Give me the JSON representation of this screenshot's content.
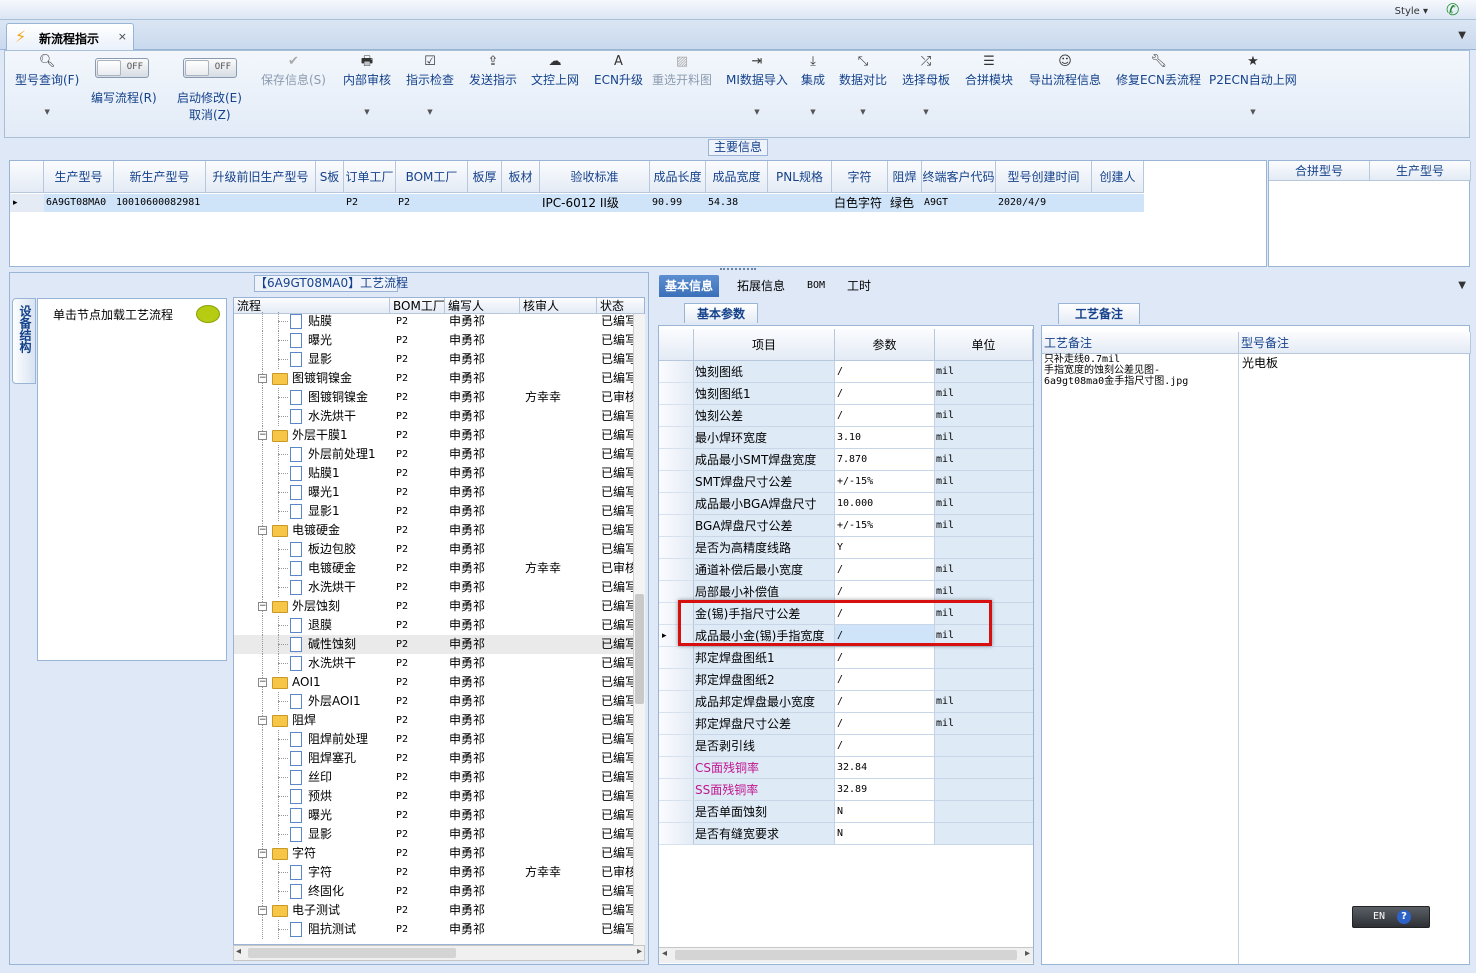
{
  "titlebar": {
    "style_label": "Style"
  },
  "doc_tab": {
    "title": "新流程指示",
    "close": "×"
  },
  "ribbon": {
    "query": "型号查询(F)",
    "edit_flow": "编写流程(R)",
    "edit_toggle": "OFF",
    "auto_edit": "启动修改(E)",
    "auto_toggle": "OFF",
    "cancel": "取消(Z)",
    "save": "保存信息(S)",
    "internal_review": "内部审核",
    "guide_check": "指示检查",
    "send": "发送指示",
    "upload": "文控上网",
    "ecn_upgrade": "ECN升级",
    "reselect": "重选开料图",
    "mi_import": "MI数据导入",
    "integrate": "集成",
    "compare": "数据对比",
    "select_board": "选择母板",
    "merge": "合拼模块",
    "export": "导出流程信息",
    "fix_ecn": "修复ECN丢流程",
    "p2ecn": "P2ECN自动上网"
  },
  "main_info": {
    "title": "主要信息",
    "columns": [
      "生产型号",
      "新生产型号",
      "升级前旧生产型号",
      "S板",
      "订单工厂",
      "BOM工厂",
      "板厚",
      "板材",
      "验收标准",
      "成品长度",
      "成品宽度",
      "PNL规格",
      "字符",
      "阻焊",
      "终端客户代码",
      "型号创建时间",
      "创建人"
    ],
    "row": [
      "6A9GT08MA0",
      "10010600082981",
      "",
      "",
      "P2",
      "P2",
      "",
      "",
      "IPC-6012 II级",
      "90.99",
      "54.38",
      "",
      "白色字符",
      "绿色",
      "A9GT",
      "2020/4/9",
      ""
    ],
    "side_columns": [
      "合拼型号",
      "生产型号"
    ]
  },
  "flow": {
    "title": "【6A9GT08MA0】工艺流程",
    "vertical_tab": "设备结构",
    "node_hint": "单击节点加载工艺流程",
    "columns": [
      "流程",
      "BOM工厂",
      "编写人",
      "核审人",
      "状态"
    ],
    "rows": [
      {
        "name": "贴膜",
        "level": 2,
        "type": "doc",
        "bom": "P2",
        "writer": "申勇祁",
        "reviewer": "",
        "status": "已编写"
      },
      {
        "name": "曝光",
        "level": 2,
        "type": "doc",
        "bom": "P2",
        "writer": "申勇祁",
        "reviewer": "",
        "status": "已编写"
      },
      {
        "name": "显影",
        "level": 2,
        "type": "doc",
        "bom": "P2",
        "writer": "申勇祁",
        "reviewer": "",
        "status": "已编写"
      },
      {
        "name": "图镀铜镍金",
        "level": 1,
        "type": "folder",
        "bom": "P2",
        "writer": "申勇祁",
        "reviewer": "",
        "status": "已编写"
      },
      {
        "name": "图镀铜镍金",
        "level": 2,
        "type": "doc",
        "bom": "P2",
        "writer": "申勇祁",
        "reviewer": "方幸幸",
        "status": "已审核"
      },
      {
        "name": "水洗烘干",
        "level": 2,
        "type": "doc",
        "bom": "P2",
        "writer": "申勇祁",
        "reviewer": "",
        "status": "已编写"
      },
      {
        "name": "外层干膜1",
        "level": 1,
        "type": "folder",
        "bom": "P2",
        "writer": "申勇祁",
        "reviewer": "",
        "status": "已编写"
      },
      {
        "name": "外层前处理1",
        "level": 2,
        "type": "doc",
        "bom": "P2",
        "writer": "申勇祁",
        "reviewer": "",
        "status": "已编写"
      },
      {
        "name": "贴膜1",
        "level": 2,
        "type": "doc",
        "bom": "P2",
        "writer": "申勇祁",
        "reviewer": "",
        "status": "已编写"
      },
      {
        "name": "曝光1",
        "level": 2,
        "type": "doc",
        "bom": "P2",
        "writer": "申勇祁",
        "reviewer": "",
        "status": "已编写"
      },
      {
        "name": "显影1",
        "level": 2,
        "type": "doc",
        "bom": "P2",
        "writer": "申勇祁",
        "reviewer": "",
        "status": "已编写"
      },
      {
        "name": "电镀硬金",
        "level": 1,
        "type": "folder",
        "bom": "P2",
        "writer": "申勇祁",
        "reviewer": "",
        "status": "已编写"
      },
      {
        "name": "板边包胶",
        "level": 2,
        "type": "doc",
        "bom": "P2",
        "writer": "申勇祁",
        "reviewer": "",
        "status": "已编写"
      },
      {
        "name": "电镀硬金",
        "level": 2,
        "type": "doc",
        "bom": "P2",
        "writer": "申勇祁",
        "reviewer": "方幸幸",
        "status": "已审核"
      },
      {
        "name": "水洗烘干",
        "level": 2,
        "type": "doc",
        "bom": "P2",
        "writer": "申勇祁",
        "reviewer": "",
        "status": "已编写"
      },
      {
        "name": "外层蚀刻",
        "level": 1,
        "type": "folder",
        "bom": "P2",
        "writer": "申勇祁",
        "reviewer": "",
        "status": "已编写"
      },
      {
        "name": "退膜",
        "level": 2,
        "type": "doc",
        "bom": "P2",
        "writer": "申勇祁",
        "reviewer": "",
        "status": "已编写"
      },
      {
        "name": "碱性蚀刻",
        "level": 2,
        "type": "doc",
        "bom": "P2",
        "writer": "申勇祁",
        "reviewer": "",
        "status": "已编写",
        "selected": true
      },
      {
        "name": "水洗烘干",
        "level": 2,
        "type": "doc",
        "bom": "P2",
        "writer": "申勇祁",
        "reviewer": "",
        "status": "已编写"
      },
      {
        "name": "AOI1",
        "level": 1,
        "type": "folder",
        "bom": "P2",
        "writer": "申勇祁",
        "reviewer": "",
        "status": "已编写"
      },
      {
        "name": "外层AOI1",
        "level": 2,
        "type": "doc",
        "bom": "P2",
        "writer": "申勇祁",
        "reviewer": "",
        "status": "已编写"
      },
      {
        "name": "阻焊",
        "level": 1,
        "type": "folder",
        "bom": "P2",
        "writer": "申勇祁",
        "reviewer": "",
        "status": "已编写"
      },
      {
        "name": "阻焊前处理",
        "level": 2,
        "type": "doc",
        "bom": "P2",
        "writer": "申勇祁",
        "reviewer": "",
        "status": "已编写"
      },
      {
        "name": "阻焊塞孔",
        "level": 2,
        "type": "doc",
        "bom": "P2",
        "writer": "申勇祁",
        "reviewer": "",
        "status": "已编写"
      },
      {
        "name": "丝印",
        "level": 2,
        "type": "doc",
        "bom": "P2",
        "writer": "申勇祁",
        "reviewer": "",
        "status": "已编写"
      },
      {
        "name": "预烘",
        "level": 2,
        "type": "doc",
        "bom": "P2",
        "writer": "申勇祁",
        "reviewer": "",
        "status": "已编写"
      },
      {
        "name": "曝光",
        "level": 2,
        "type": "doc",
        "bom": "P2",
        "writer": "申勇祁",
        "reviewer": "",
        "status": "已编写"
      },
      {
        "name": "显影",
        "level": 2,
        "type": "doc",
        "bom": "P2",
        "writer": "申勇祁",
        "reviewer": "",
        "status": "已编写"
      },
      {
        "name": "字符",
        "level": 1,
        "type": "folder",
        "bom": "P2",
        "writer": "申勇祁",
        "reviewer": "",
        "status": "已编写"
      },
      {
        "name": "字符",
        "level": 2,
        "type": "doc",
        "bom": "P2",
        "writer": "申勇祁",
        "reviewer": "方幸幸",
        "status": "已审核"
      },
      {
        "name": "终固化",
        "level": 2,
        "type": "doc",
        "bom": "P2",
        "writer": "申勇祁",
        "reviewer": "",
        "status": "已编写"
      },
      {
        "name": "电子测试",
        "level": 1,
        "type": "folder",
        "bom": "P2",
        "writer": "申勇祁",
        "reviewer": "",
        "status": "已编写"
      },
      {
        "name": "阻抗测试",
        "level": 2,
        "type": "doc",
        "bom": "P2",
        "writer": "申勇祁",
        "reviewer": "",
        "status": "已编写"
      }
    ]
  },
  "right_tabs": [
    "基本信息",
    "拓展信息",
    "BOM",
    "工时"
  ],
  "params": {
    "sub_tab": "基本参数",
    "columns": [
      "项目",
      "参数",
      "单位"
    ],
    "rows": [
      {
        "name": "蚀刻图纸",
        "value": "/",
        "unit": "mil"
      },
      {
        "name": "蚀刻图纸1",
        "value": "/",
        "unit": "mil"
      },
      {
        "name": "蚀刻公差",
        "value": "/",
        "unit": "mil"
      },
      {
        "name": "最小焊环宽度",
        "value": "3.10",
        "unit": "mil"
      },
      {
        "name": "成品最小SMT焊盘宽度",
        "value": "7.870",
        "unit": "mil"
      },
      {
        "name": "SMT焊盘尺寸公差",
        "value": "+/-15%",
        "unit": "mil"
      },
      {
        "name": "成品最小BGA焊盘尺寸",
        "value": "10.000",
        "unit": "mil"
      },
      {
        "name": "BGA焊盘尺寸公差",
        "value": "+/-15%",
        "unit": "mil"
      },
      {
        "name": "是否为高精度线路",
        "value": "Y",
        "unit": ""
      },
      {
        "name": "通道补偿后最小宽度",
        "value": "/",
        "unit": "mil"
      },
      {
        "name": "局部最小补偿值",
        "value": "/",
        "unit": "mil"
      },
      {
        "name": "金(锡)手指尺寸公差",
        "value": "/",
        "unit": "mil"
      },
      {
        "name": "成品最小金(锡)手指宽度",
        "value": "/",
        "unit": "mil",
        "selected": true
      },
      {
        "name": "邦定焊盘图纸1",
        "value": "/",
        "unit": ""
      },
      {
        "name": "邦定焊盘图纸2",
        "value": "/",
        "unit": ""
      },
      {
        "name": "成品邦定焊盘最小宽度",
        "value": "/",
        "unit": "mil"
      },
      {
        "name": "邦定焊盘尺寸公差",
        "value": "/",
        "unit": "mil"
      },
      {
        "name": "是否剥引线",
        "value": "/",
        "unit": ""
      },
      {
        "name": "CS面残铜率",
        "value": "32.84",
        "unit": "",
        "pink": true
      },
      {
        "name": "SS面残铜率",
        "value": "32.89",
        "unit": "",
        "pink": true
      },
      {
        "name": "是否单面蚀刻",
        "value": "N",
        "unit": ""
      },
      {
        "name": "是否有缝宽要求",
        "value": "N",
        "unit": ""
      }
    ]
  },
  "remarks": {
    "tab": "工艺备注",
    "col1": "工艺备注",
    "col2": "型号备注",
    "process_note": "只补走线0.7mil\n手指宽度的蚀刻公差见图-\n6a9gt08ma0金手指尺寸图.jpg",
    "model_note": "光电板"
  },
  "langbar": {
    "lang": "EN",
    "help": "?"
  },
  "colors": {
    "highlight": "#d80f0f",
    "accent": "#3b6fb8",
    "pink_label": "#c0168f"
  }
}
